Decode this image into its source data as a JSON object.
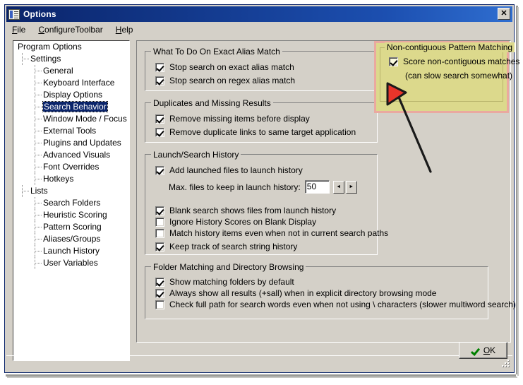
{
  "window": {
    "title": "Options",
    "icon": "options-window-icon",
    "close_label": "✕"
  },
  "menubar": {
    "items": [
      {
        "label": "File",
        "accel": "F"
      },
      {
        "label": "ConfigureToolbar",
        "accel": "C"
      },
      {
        "label": "Help",
        "accel": "H"
      }
    ]
  },
  "tree": {
    "items": [
      {
        "label": "Program Options",
        "level": 0,
        "selected": false
      },
      {
        "label": "Settings",
        "level": 1,
        "selected": false
      },
      {
        "label": "General",
        "level": 2,
        "selected": false
      },
      {
        "label": "Keyboard Interface",
        "level": 2,
        "selected": false
      },
      {
        "label": "Display Options",
        "level": 2,
        "selected": false
      },
      {
        "label": "Search Behavior",
        "level": 2,
        "selected": true
      },
      {
        "label": "Window Mode / Focus",
        "level": 2,
        "selected": false
      },
      {
        "label": "External Tools",
        "level": 2,
        "selected": false
      },
      {
        "label": "Plugins and Updates",
        "level": 2,
        "selected": false
      },
      {
        "label": "Advanced Visuals",
        "level": 2,
        "selected": false
      },
      {
        "label": "Font Overrides",
        "level": 2,
        "selected": false
      },
      {
        "label": "Hotkeys",
        "level": 2,
        "selected": false
      },
      {
        "label": "Lists",
        "level": 1,
        "selected": false
      },
      {
        "label": "Search Folders",
        "level": 2,
        "selected": false
      },
      {
        "label": "Heuristic Scoring",
        "level": 2,
        "selected": false
      },
      {
        "label": "Pattern Scoring",
        "level": 2,
        "selected": false
      },
      {
        "label": "Aliases/Groups",
        "level": 2,
        "selected": false
      },
      {
        "label": "Launch History",
        "level": 2,
        "selected": false
      },
      {
        "label": "User Variables",
        "level": 2,
        "selected": false
      }
    ]
  },
  "groups": {
    "exact_alias": {
      "title": "What To Do On Exact Alias Match",
      "options": [
        {
          "label": "Stop search on exact alias match",
          "checked": true
        },
        {
          "label": "Stop search on regex alias match",
          "checked": true
        }
      ]
    },
    "duplicates": {
      "title": "Duplicates and Missing Results",
      "options": [
        {
          "label": "Remove missing items before display",
          "checked": true
        },
        {
          "label": "Remove duplicate links to same target application",
          "checked": true
        }
      ]
    },
    "history": {
      "title": "Launch/Search History",
      "add_launched": {
        "label": "Add launched files to launch history",
        "checked": true
      },
      "max_files_label": "Max. files to keep in launch history:",
      "max_files_value": "50",
      "spin_down": "◄",
      "spin_up": "►",
      "options": [
        {
          "label": "Blank search shows files from launch history",
          "checked": true
        },
        {
          "label": "Ignore History Scores on Blank Display",
          "checked": false
        },
        {
          "label": "Match history items even when not in current search paths",
          "checked": false
        },
        {
          "label": "Keep track of search string history",
          "checked": true
        }
      ]
    },
    "folder_matching": {
      "title": "Folder Matching and Directory Browsing",
      "options": [
        {
          "label": "Show matching folders by default",
          "checked": true
        },
        {
          "label": "Always show all results (+sall) when in explicit directory browsing mode",
          "checked": true
        },
        {
          "label": "Check full path for search words even when not using \\ characters (slower multiword search)",
          "checked": false
        }
      ]
    },
    "noncontiguous": {
      "title": "Non-contiguous Pattern Matching",
      "option": {
        "label": "Score non-contiguous matches",
        "checked": true
      },
      "note": "(can slow search somewhat)",
      "highlight_border_color": "#eaa9a0",
      "highlight_fill_color": "#dcd98c"
    }
  },
  "annotation": {
    "arrow_color": "#e03020",
    "arrow_outline_color": "#1a1a1a"
  },
  "footer": {
    "ok_label": "OK",
    "ok_accel": "O",
    "ok_icon": "green-check-icon"
  }
}
